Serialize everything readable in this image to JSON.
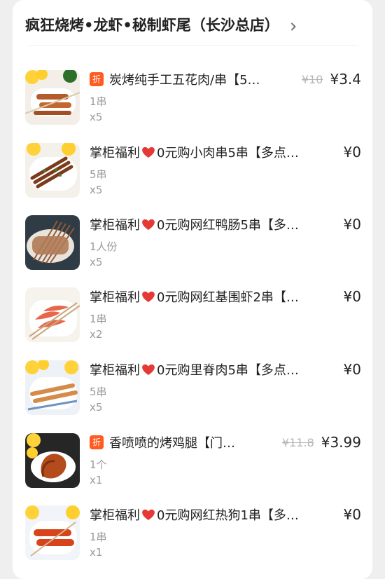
{
  "store": {
    "title": "疯狂烧烤•龙虾•秘制虾尾（长沙总店）",
    "chevron_icon": "chevron-right-icon"
  },
  "colors": {
    "discount_badge": "#ff5a1f",
    "heart": "#e53935",
    "text_primary": "#222222",
    "text_secondary": "#9a9a9a"
  },
  "items": [
    {
      "badge": "折",
      "name": "炭烤纯手工五花肉/串【5…",
      "old_price": "¥10",
      "price": "¥3.4",
      "spec": "1串",
      "qty": "x5",
      "image": "pork-belly-skewers-image"
    },
    {
      "name_prefix": "掌柜福利",
      "name_suffix": "0元购小肉串5串【多点…",
      "price": "¥0",
      "spec": "5串",
      "qty": "x5",
      "image": "meat-skewers-image"
    },
    {
      "name_prefix": "掌柜福利",
      "name_suffix": "0元购网红鸭肠5串【多…",
      "price": "¥0",
      "spec": "1人份",
      "qty": "x5",
      "image": "duck-intestine-skewers-image"
    },
    {
      "name_prefix": "掌柜福利",
      "name_suffix": "0元购网红基围虾2串【…",
      "price": "¥0",
      "spec": "1串",
      "qty": "x2",
      "image": "shrimp-skewers-image"
    },
    {
      "name_prefix": "掌柜福利",
      "name_suffix": "0元购里脊肉5串【多点…",
      "price": "¥0",
      "spec": "5串",
      "qty": "x5",
      "image": "tenderloin-skewers-image"
    },
    {
      "badge": "折",
      "name": "香喷喷的烤鸡腿【门…",
      "old_price": "¥11.8",
      "price": "¥3.99",
      "spec": "1个",
      "qty": "x1",
      "image": "roast-chicken-leg-image"
    },
    {
      "name_prefix": "掌柜福利",
      "name_suffix": "0元购网红热狗1串【多…",
      "price": "¥0",
      "spec": "1串",
      "qty": "x1",
      "image": "hot-dog-skewer-image"
    }
  ]
}
